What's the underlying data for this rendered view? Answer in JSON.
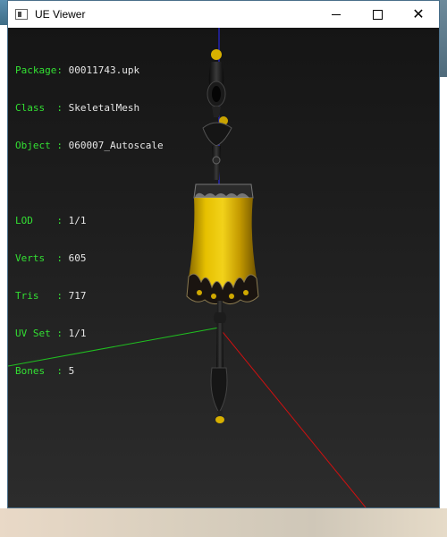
{
  "window": {
    "title": "UE Viewer",
    "buttons": {
      "minimize": "minimize-icon",
      "maximize": "maximize-icon",
      "close": "close-icon"
    }
  },
  "info": {
    "package": {
      "label": "Package:",
      "value": "00011743.upk"
    },
    "class": {
      "label": "Class  :",
      "value": "SkeletalMesh"
    },
    "object": {
      "label": "Object :",
      "value": "060007_Autoscale"
    },
    "lod": {
      "label": "LOD    :",
      "value": "1/1"
    },
    "verts": {
      "label": "Verts  :",
      "value": "605"
    },
    "tris": {
      "label": "Tris   :",
      "value": "717"
    },
    "uvset": {
      "label": "UV Set :",
      "value": "1/1"
    },
    "bones": {
      "label": "Bones  :",
      "value": "5"
    }
  },
  "colors": {
    "label_green": "#33e033",
    "text": "#e6e6e6",
    "axis_x": "#d01010",
    "axis_y": "#20c020",
    "axis_z": "#2a2aff",
    "mesh_gold": "#d8b000"
  }
}
